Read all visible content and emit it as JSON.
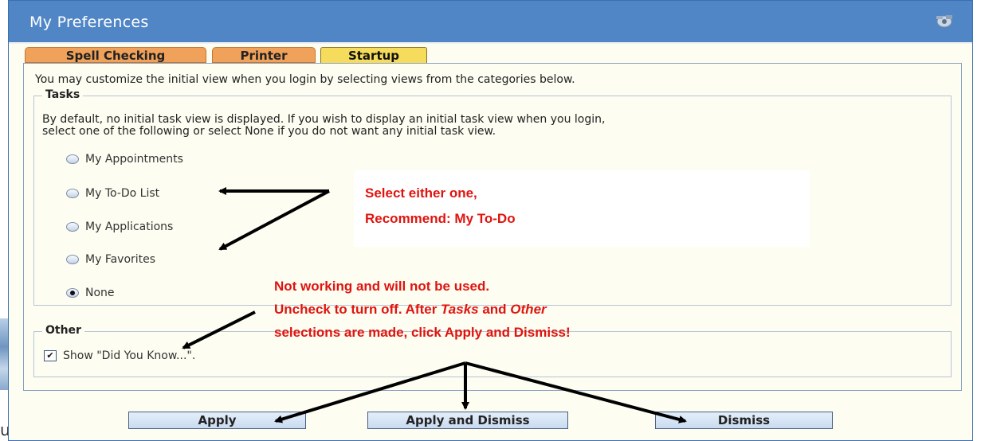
{
  "window": {
    "title": "My Preferences",
    "title_icon": "preferences-icon"
  },
  "tabs": [
    {
      "label": "Spell Checking",
      "active": false
    },
    {
      "label": "Printer",
      "active": false
    },
    {
      "label": "Startup",
      "active": true
    }
  ],
  "startup": {
    "intro": "You may customize the initial view when you login by selecting views from the categories below.",
    "tasks": {
      "legend": "Tasks",
      "description_line1": "By default, no initial task view is displayed. If you wish to display an initial task view when you login,",
      "description_line2": "select one of the following or select None if you do not want any initial task view.",
      "options": [
        {
          "label": "My Appointments",
          "checked": false
        },
        {
          "label": "My To-Do List",
          "checked": false
        },
        {
          "label": "My Applications",
          "checked": false
        },
        {
          "label": "My Favorites",
          "checked": false
        },
        {
          "label": "None",
          "checked": true
        }
      ]
    },
    "other": {
      "legend": "Other",
      "show_did_you_know": {
        "label": "Show \"Did You Know...\".",
        "checked": true
      }
    }
  },
  "annotations": {
    "callout_line1": "Select either one,",
    "callout_line2": "Recommend: My To-Do",
    "note_line1": "Not working and will not be used.",
    "note_line2_a": "Uncheck to turn off. After ",
    "note_line2_b": "Tasks",
    "note_line2_c": " and ",
    "note_line2_d": "Other",
    "note_line3": "selections are made, click Apply and Dismiss!",
    "color": "#e0140f"
  },
  "buttons": {
    "apply": "Apply",
    "apply_and_dismiss": "Apply and Dismiss",
    "dismiss": "Dismiss"
  },
  "background_fragment": "u"
}
